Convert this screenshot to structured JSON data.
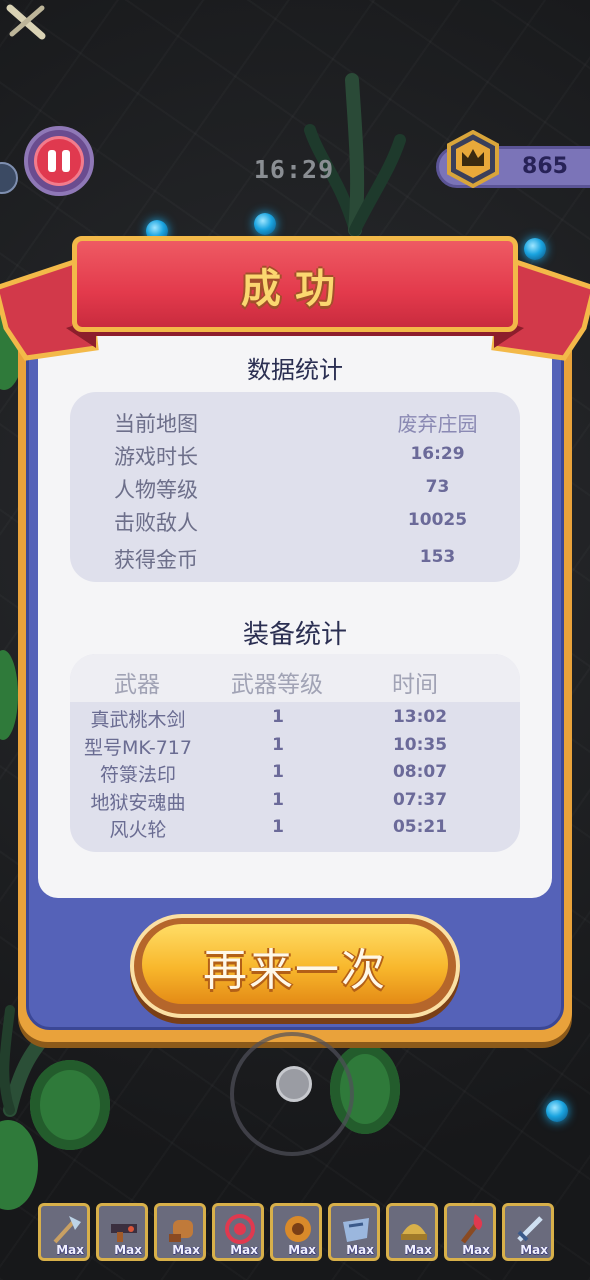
{
  "hud": {
    "timer": "16:29",
    "coins": "865"
  },
  "result": {
    "title": "成功",
    "data_section_title": "数据统计",
    "stats": [
      {
        "label": "当前地图",
        "value": "废弃庄园"
      },
      {
        "label": "游戏时长",
        "value": "16:29"
      },
      {
        "label": "人物等级",
        "value": "73"
      },
      {
        "label": "击败敌人",
        "value": "10025"
      },
      {
        "label": "获得金币",
        "value": "153"
      }
    ],
    "equip_section_title": "装备统计",
    "equip_headers": {
      "weapon": "武器",
      "level": "武器等级",
      "time": "时间"
    },
    "equipment": [
      {
        "name": "真武桃木剑",
        "level": "1",
        "time": "13:02"
      },
      {
        "name": "型号MK-717",
        "level": "1",
        "time": "10:35"
      },
      {
        "name": "符箓法印",
        "level": "1",
        "time": "08:07"
      },
      {
        "name": "地狱安魂曲",
        "level": "1",
        "time": "07:37"
      },
      {
        "name": "风火轮",
        "level": "1",
        "time": "05:21"
      }
    ],
    "retry_label": "再来一次"
  },
  "weapon_slots": [
    {
      "icon": "axe-icon",
      "badge": "Max"
    },
    {
      "icon": "gun-icon",
      "badge": "Max"
    },
    {
      "icon": "fist-icon",
      "badge": "Max"
    },
    {
      "icon": "seal-icon",
      "badge": "Max"
    },
    {
      "icon": "wheel-icon",
      "badge": "Max"
    },
    {
      "icon": "armor-icon",
      "badge": "Max"
    },
    {
      "icon": "helmet-icon",
      "badge": "Max"
    },
    {
      "icon": "torch-icon",
      "badge": "Max"
    },
    {
      "icon": "sword-icon",
      "badge": "Max"
    }
  ]
}
